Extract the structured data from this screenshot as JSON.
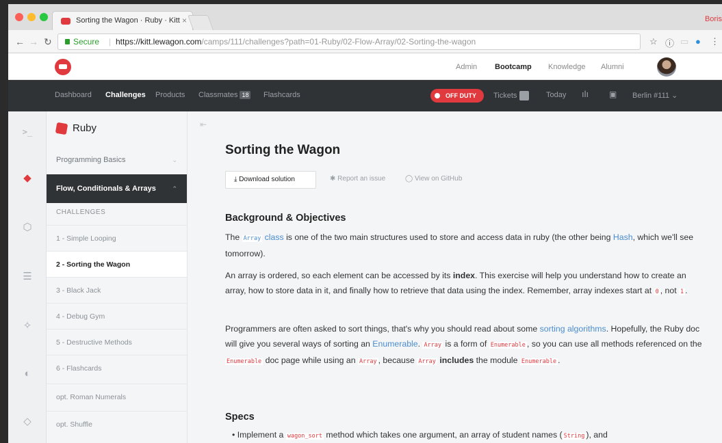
{
  "browser": {
    "tab_title": "Sorting the Wagon · Ruby · Kitt",
    "tab_close": "×",
    "profile_name": "Boris",
    "secure_label": "Secure",
    "url_host": "https://kitt.lewagon.com",
    "url_path": "/camps/111/challenges?path=01-Ruby/02-Flow-Array/02-Sorting-the-wagon",
    "colors": {
      "close": "#fc5f57",
      "minimize": "#fdbc2e",
      "zoom": "#28c840"
    }
  },
  "site_header": {
    "links": [
      "Admin",
      "Bootcamp",
      "Knowledge",
      "Alumni"
    ]
  },
  "camp_nav": {
    "dashboard": "Dashboard",
    "challenges": "Challenges",
    "products": "Products",
    "classmates": "Classmates",
    "classmates_count": "18",
    "flashcards": "Flashcards",
    "off_duty": "OFF DUTY",
    "tickets": "Tickets",
    "today": "Today",
    "batch": "Berlin #111 ⌄"
  },
  "sidebar": {
    "title": "Ruby",
    "section_basics": "Programming Basics",
    "section_flow": "Flow, Conditionals & Arrays",
    "subheader": "CHALLENGES",
    "items": [
      "1 - Simple Looping",
      "2 - Sorting the Wagon",
      "3 - Black Jack",
      "4 - Debug Gym",
      "5 - Destructive Methods",
      "6 - Flashcards",
      "opt. Roman Numerals",
      "opt. Shuffle"
    ]
  },
  "main": {
    "title": "Sorting the Wagon",
    "download": "Download solution",
    "report": "Report an issue",
    "github": "View on GitHub",
    "bg_heading": "Background & Objectives",
    "p1": {
      "a": "The ",
      "code": "Array",
      "link": "class",
      "b": " is one of the two main structures used to store and access data in ruby (the other being ",
      "hash": "Hash",
      "c": ", which we'll see tomorrow)."
    },
    "p2": {
      "a": "An array is ordered, so each element can be accessed by its ",
      "bold": "index",
      "b": ". This exercise will help you understand how to create an array, how to store data in it, and finally how to retrieve that data using the index. Remember, array indexes start at ",
      "zero": "0",
      "c": ", not ",
      "one": "1",
      "d": "."
    },
    "p3": {
      "a": "Programmers are often asked to sort things, that's why you should read about some ",
      "link1": "sorting algorithms",
      "b": ". Hopefully, the Ruby doc will give you several ways of sorting an ",
      "link2": "Enumerable",
      "c": ". ",
      "code1": "Array",
      "d": " is a form of ",
      "code2": "Enumerable",
      "e": ", so you can use all methods referenced on the ",
      "code3": "Enumerable",
      "f": " doc page while using an ",
      "code4": "Array",
      "g": ", because ",
      "code5": "Array",
      "h": " ",
      "bold": "includes",
      "i": " the module ",
      "code6": "Enumerable",
      "j": "."
    },
    "specs_heading": "Specs",
    "spec1": {
      "a": "Implement a ",
      "code1": "wagon_sort",
      "b": " method which takes one argument, an array of student names (",
      "code2": "String",
      "c": "), and"
    }
  }
}
